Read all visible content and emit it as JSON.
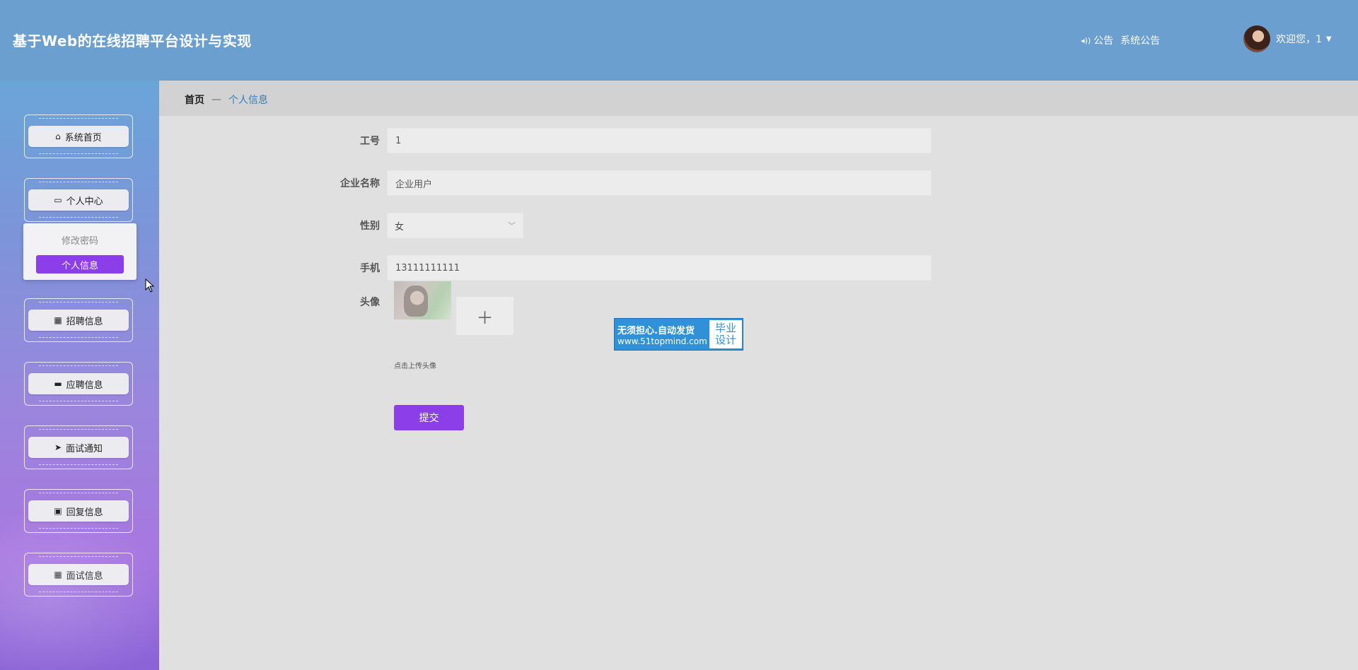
{
  "header": {
    "title": "基于Web的在线招聘平台设计与实现",
    "notice_label": "公告",
    "system_notice_label": "系统公告",
    "welcome_text": "欢迎您，1"
  },
  "sidebar": {
    "items": [
      {
        "label": "系统首页",
        "icon": "home-icon"
      },
      {
        "label": "个人中心",
        "icon": "card-icon"
      },
      {
        "label": "招聘信息",
        "icon": "grid-icon"
      },
      {
        "label": "应聘信息",
        "icon": "monitor-icon"
      },
      {
        "label": "面试通知",
        "icon": "send-icon"
      },
      {
        "label": "回复信息",
        "icon": "clipboard-icon"
      },
      {
        "label": "面试信息",
        "icon": "grid-icon"
      }
    ],
    "submenu": {
      "change_password": "修改密码",
      "personal_info": "个人信息"
    }
  },
  "breadcrumb": {
    "home": "首页",
    "separator": "—",
    "current": "个人信息"
  },
  "form": {
    "employee_id": {
      "label": "工号",
      "value": "1"
    },
    "company_name": {
      "label": "企业名称",
      "value": "企业用户"
    },
    "gender": {
      "label": "性别",
      "value": "女"
    },
    "phone": {
      "label": "手机",
      "value": "13111111111"
    },
    "avatar": {
      "label": "头像",
      "hint": "点击上传头像"
    },
    "submit_label": "提交"
  },
  "watermark": {
    "line1": "无须担心.自动发货",
    "line2": "www.51topmind.com",
    "side_line1": "毕业",
    "side_line2": "设计"
  },
  "colors": {
    "header_bg": "#6a9fd0",
    "accent_purple": "#8c3ee8",
    "breadcrumb_active": "#2f7fc4"
  }
}
